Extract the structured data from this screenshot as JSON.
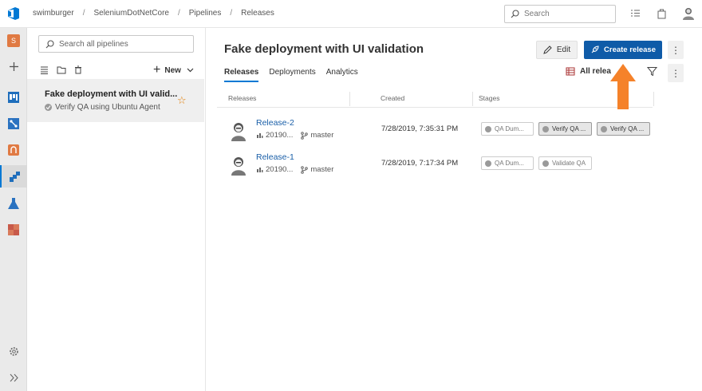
{
  "header": {
    "breadcrumbs": [
      "swimburger",
      "SeleniumDotNetCore",
      "Pipelines",
      "Releases"
    ],
    "search_placeholder": "Search"
  },
  "rail": {
    "project_initial": "S"
  },
  "pane": {
    "search_placeholder": "Search all pipelines",
    "new_label": "New",
    "pipeline": {
      "title": "Fake deployment with UI valid...",
      "subtitle": "Verify QA using Ubuntu Agent"
    }
  },
  "main": {
    "title": "Fake deployment with UI validation",
    "edit_label": "Edit",
    "create_label": "Create release",
    "tabs": [
      "Releases",
      "Deployments",
      "Analytics"
    ],
    "filter_label": "All relea",
    "columns": [
      "Releases",
      "Created",
      "Stages"
    ],
    "rows": [
      {
        "name": "Release-2",
        "build": "20190...",
        "branch": "master",
        "created": "7/28/2019, 7:35:31 PM",
        "stages": [
          "QA Dum...",
          "Verify QA ...",
          "Verify QA ..."
        ]
      },
      {
        "name": "Release-1",
        "build": "20190...",
        "branch": "master",
        "created": "7/28/2019, 7:17:34 PM",
        "stages": [
          "QA Dum...",
          "Validate QA"
        ]
      }
    ]
  },
  "colors": {
    "accent": "#0078d4",
    "primary_button": "#0f5ba8",
    "arrow": "#f5822a",
    "star": "#e07a00"
  }
}
